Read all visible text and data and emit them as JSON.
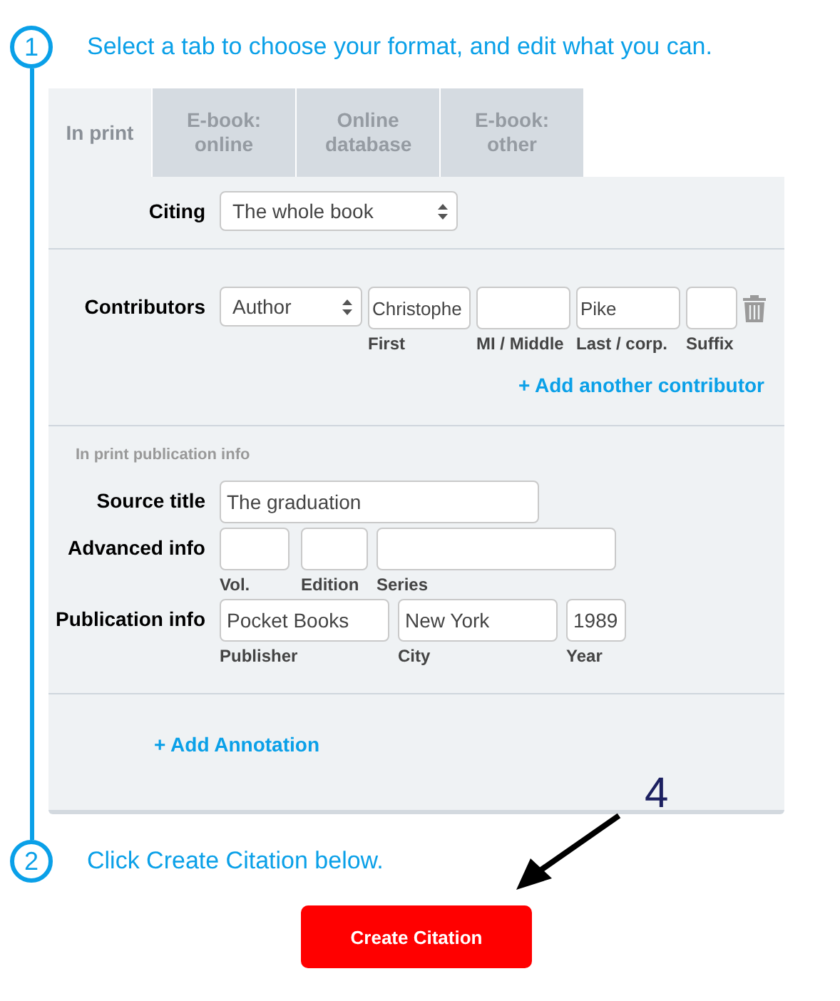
{
  "steps": [
    {
      "number": "1",
      "text": "Select a tab to choose your format, and edit what you can."
    },
    {
      "number": "2",
      "text": "Click Create Citation below."
    }
  ],
  "tabs": [
    {
      "label": "In print",
      "selected": true
    },
    {
      "label": "E-book: online",
      "selected": false
    },
    {
      "label": "Online database",
      "selected": false
    },
    {
      "label": "E-book: other",
      "selected": false
    }
  ],
  "citing": {
    "label": "Citing",
    "value": "The whole book"
  },
  "contributors": {
    "label": "Contributors",
    "role": "Author",
    "fields": [
      {
        "value": "Christophe",
        "caption": "First"
      },
      {
        "caption": "MI / Middle"
      },
      {
        "value": "Pike",
        "caption": "Last / corp."
      },
      {
        "caption": "Suffix"
      }
    ],
    "add_link": "+ Add another contributor"
  },
  "publication": {
    "heading": "In print publication info",
    "rows": [
      {
        "label": "Source title",
        "fields": [
          {
            "value": "The graduation"
          }
        ]
      },
      {
        "label": "Advanced info",
        "fields": [
          {
            "caption": "Vol."
          },
          {
            "caption": "Edition"
          },
          {
            "caption": "Series"
          }
        ]
      },
      {
        "label": "Publication info",
        "fields": [
          {
            "value": "Pocket Books",
            "caption": "Publisher"
          },
          {
            "value": "New York",
            "caption": "City"
          },
          {
            "value": "1989",
            "caption": "Year"
          }
        ]
      }
    ]
  },
  "annotation_link": "+ Add Annotation",
  "callout": "4",
  "create_button": "Create Citation"
}
